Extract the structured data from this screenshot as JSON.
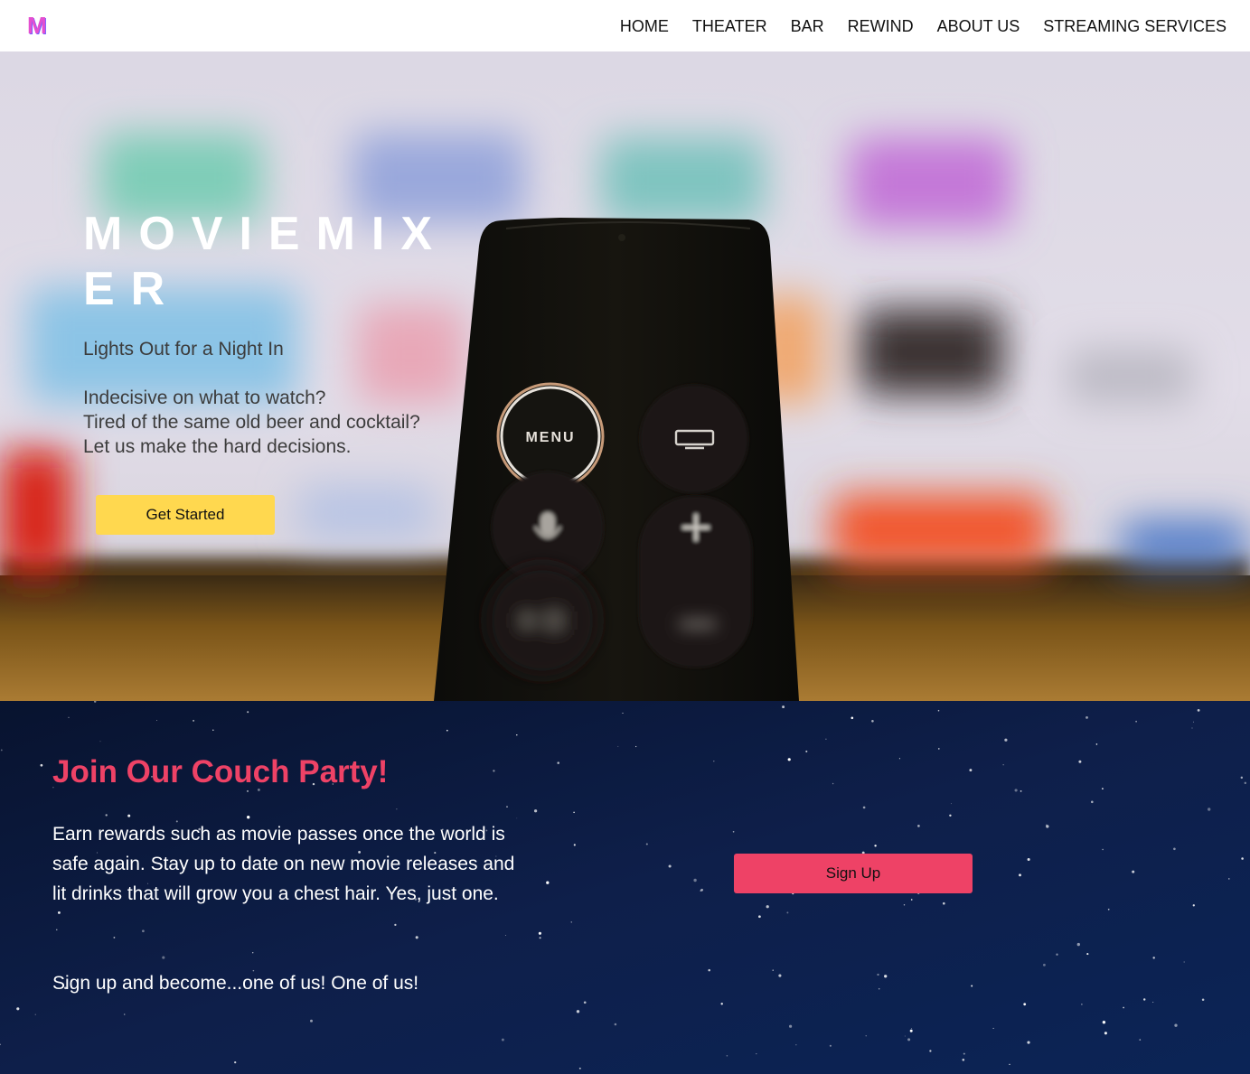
{
  "nav": {
    "logo": "M",
    "links": [
      "HOME",
      "THEATER",
      "BAR",
      "REWIND",
      "ABOUT US",
      "STREAMING SERVICES"
    ]
  },
  "hero": {
    "title": "MOVIEMIXER",
    "tagline": "Lights Out for a Night In",
    "lines": [
      "Indecisive on what to watch?",
      "Tired of the same old beer and cocktail?",
      "Let us make the hard decisions."
    ],
    "cta_label": "Get Started",
    "remote_menu_label": "MENU"
  },
  "party": {
    "heading": "Join Our Couch Party!",
    "body": "Earn rewards such as movie passes once the world is safe again. Stay up to date on new movie releases and lit drinks that will grow you a chest hair. Yes, just one.",
    "cta_text": "Sign up and become...one of us! One of us!",
    "button_label": "Sign Up"
  },
  "colors": {
    "logo": "#e44fd0",
    "get_started": "#ffd84f",
    "accent_pink": "#ee4266",
    "night_sky": "#0c1a40"
  }
}
